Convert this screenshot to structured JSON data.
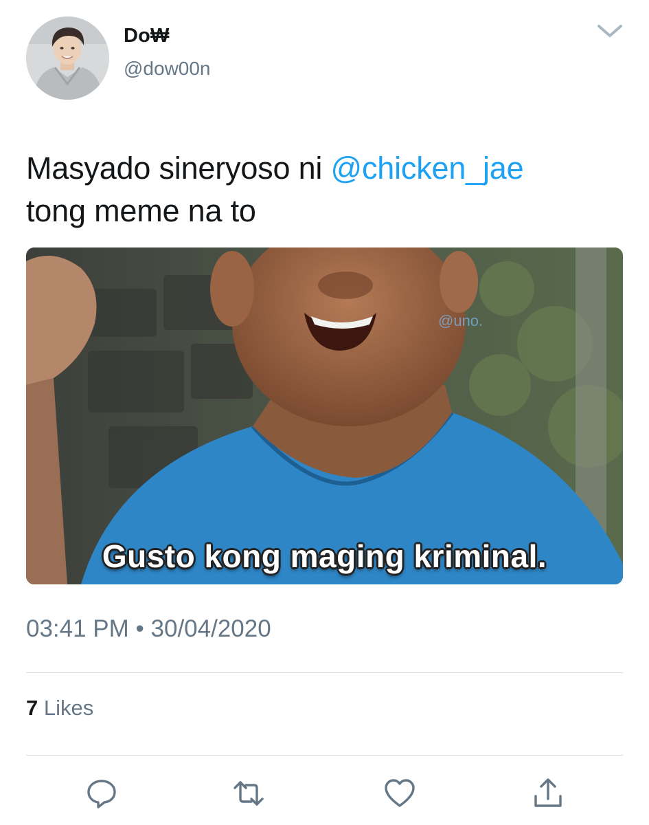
{
  "user": {
    "display_name": "Do₩",
    "handle": "@dow00n"
  },
  "tweet": {
    "text_before_mention": "Masyado sineryoso ni ",
    "mention": "@chicken_jae",
    "text_after_mention": "tong meme na to",
    "timestamp": "03:41 PM • 30/04/2020"
  },
  "media": {
    "watermark": "@uno.",
    "subtitle": "Gusto kong maging kriminal."
  },
  "stats": {
    "likes_count": "7",
    "likes_label": "Likes"
  },
  "actions": [
    {
      "icon": "reply-icon"
    },
    {
      "icon": "retweet-icon"
    },
    {
      "icon": "like-icon"
    },
    {
      "icon": "share-icon"
    }
  ],
  "colors": {
    "mention": "#1da1f2",
    "secondary_text": "#657786",
    "primary_text": "#14171a",
    "divider": "#d6dce0"
  }
}
